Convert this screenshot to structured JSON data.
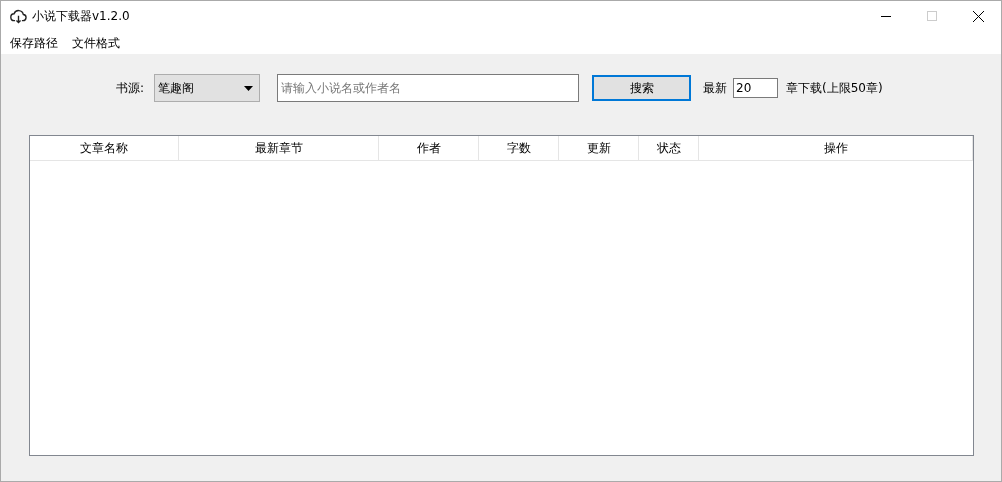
{
  "window": {
    "title": "小说下载器v1.2.0",
    "maximize_disabled": true
  },
  "menu": [
    "保存路径",
    "文件格式"
  ],
  "search_bar": {
    "source_label": "书源:",
    "source_value": "笔趣阁",
    "query": {
      "placeholder": "请输入小说名或作者名"
    },
    "search_button": "搜索",
    "latest_label": "最新",
    "latest_value": "20",
    "latest_suffix": "章下载(上限50章)"
  },
  "table": {
    "columns": [
      "文章名称",
      "最新章节",
      "作者",
      "字数",
      "更新",
      "状态",
      "操作"
    ]
  }
}
